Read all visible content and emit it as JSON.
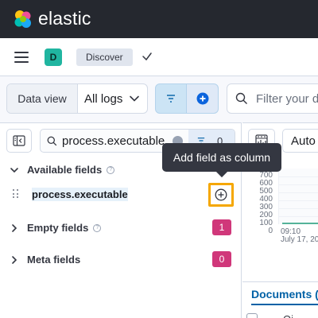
{
  "header": {
    "brand": "elastic",
    "logo_icon": "elastic-logo-icon",
    "background": "#25282f"
  },
  "navbar": {
    "menu_icon": "hamburger-icon",
    "space_initial": "D",
    "space_color": "#20b5a0",
    "breadcrumb": "Discover",
    "breadcrumb_icon": "chevron-down-icon"
  },
  "toolbar": {
    "data_view_label": "Data view",
    "data_view_value": "All logs",
    "filter_icon": "filter-icon",
    "add_filter_icon": "plus-circle-icon",
    "query_placeholder": "Filter your d"
  },
  "sidebar": {
    "collapse_icon": "collapse-sidebar-icon",
    "search_value": "process.executable",
    "filter_count": "0",
    "sections": [
      {
        "label": "Available fields",
        "count": "",
        "expanded": true
      },
      {
        "label": "Empty fields",
        "count": "1",
        "expanded": false
      },
      {
        "label": "Meta fields",
        "count": "0",
        "expanded": false
      }
    ],
    "fields": [
      {
        "name": "process.executable"
      }
    ],
    "badge_color": "#d0377a"
  },
  "tooltip": {
    "text": "Add field as column"
  },
  "chart_panel": {
    "auto_label": "Auto",
    "y_ticks": [
      "700",
      "600",
      "500",
      "400",
      "300",
      "200",
      "100",
      "0"
    ],
    "x_time": "09:10",
    "x_date": "July 17, 20",
    "series_color": "#54b399"
  },
  "documents": {
    "tab_label": "Documents (",
    "row_partial_text": "Oi"
  }
}
